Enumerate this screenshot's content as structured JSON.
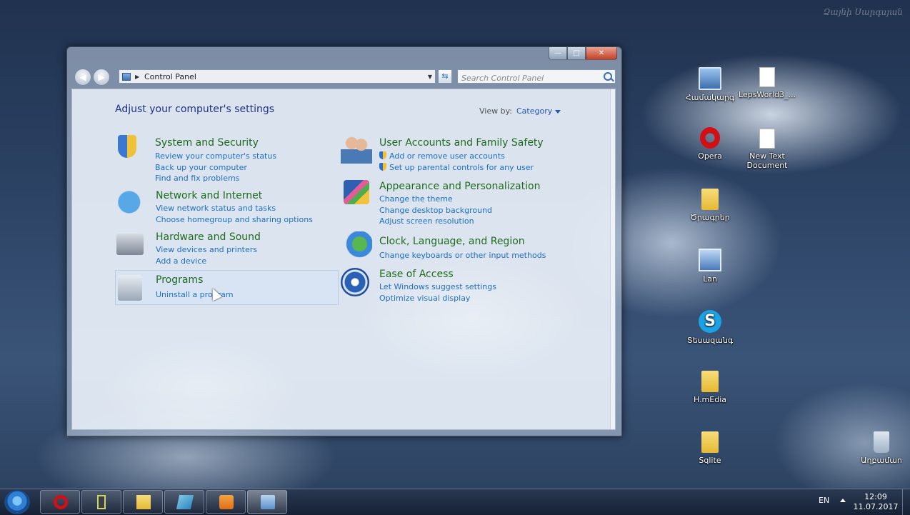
{
  "watermark": "Ձայնի Սարգսյան",
  "desktop_icons": [
    {
      "label": "Համակարգ",
      "icon": "computer-icon"
    },
    {
      "label": "LepsWorld3_...",
      "icon": "document-icon"
    },
    {
      "label": "Opera",
      "icon": "opera-icon"
    },
    {
      "label": "New Text Document",
      "icon": "text-document-icon"
    },
    {
      "label": "Ծրագրեր",
      "icon": "folder-icon"
    },
    {
      "label": "Lan",
      "icon": "network-icon"
    },
    {
      "label": "Տեսազանգ",
      "icon": "skype-icon"
    },
    {
      "label": "H.mEdia",
      "icon": "folder-icon"
    },
    {
      "label": "Sqlite",
      "icon": "folder-icon"
    },
    {
      "label": "Աղբամաn",
      "icon": "recycle-bin-icon"
    }
  ],
  "window": {
    "buttons": {
      "minimize": "—",
      "maximize": "□",
      "close": "✕"
    },
    "address": "Control Panel",
    "search_placeholder": "Search Control Panel",
    "heading": "Adjust your computer's settings",
    "view_by_label": "View by:",
    "view_by_value": "Category",
    "categories": [
      {
        "title": "System and Security",
        "icon": "security-shield-icon",
        "links": [
          "Review your computer's status",
          "Back up your computer",
          "Find and fix problems"
        ]
      },
      {
        "title": "Network and Internet",
        "icon": "network-globe-icon",
        "links": [
          "View network status and tasks",
          "Choose homegroup and sharing options"
        ]
      },
      {
        "title": "Hardware and Sound",
        "icon": "printer-icon",
        "links": [
          "View devices and printers",
          "Add a device"
        ]
      },
      {
        "title": "Programs",
        "icon": "programs-icon",
        "links": [
          "Uninstall a program"
        ]
      },
      {
        "title": "User Accounts and Family Safety",
        "icon": "users-icon",
        "links": [
          "Add or remove user accounts",
          "Set up parental controls for any user"
        ]
      },
      {
        "title": "Appearance and Personalization",
        "icon": "appearance-icon",
        "links": [
          "Change the theme",
          "Change desktop background",
          "Adjust screen resolution"
        ]
      },
      {
        "title": "Clock, Language, and Region",
        "icon": "clock-globe-icon",
        "links": [
          "Change keyboards or other input methods"
        ]
      },
      {
        "title": "Ease of Access",
        "icon": "ease-of-access-icon",
        "links": [
          "Let Windows suggest settings",
          "Optimize visual display"
        ]
      }
    ]
  },
  "taskbar": {
    "items": [
      {
        "icon": "opera-icon"
      },
      {
        "icon": "phone-icon"
      },
      {
        "icon": "folder-icon"
      },
      {
        "icon": "book-icon"
      },
      {
        "icon": "media-player-icon"
      },
      {
        "icon": "control-panel-icon",
        "active": true
      }
    ],
    "language": "EN",
    "time": "12:09",
    "date": "11.07.2017"
  }
}
